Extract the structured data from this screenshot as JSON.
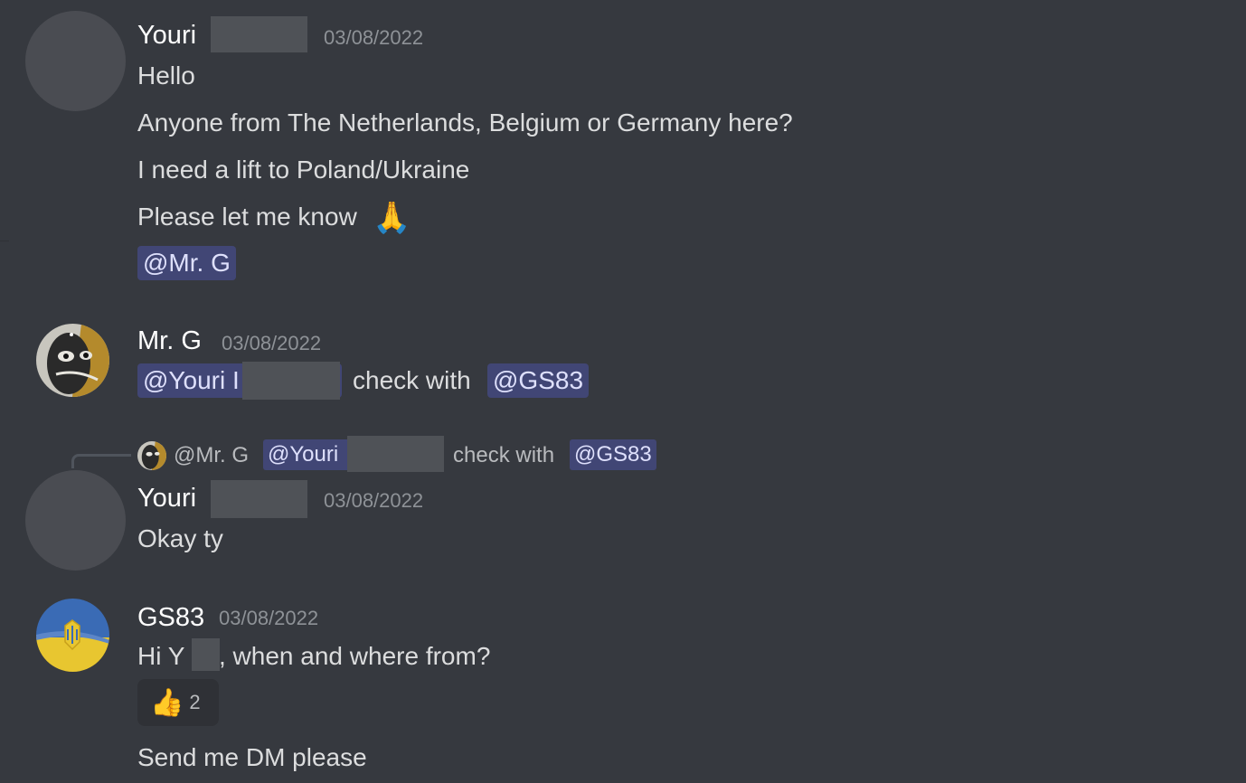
{
  "messages": {
    "m1": {
      "author": "Youri",
      "timestamp": "03/08/2022",
      "lines": [
        "Hello",
        "Anyone from The Netherlands, Belgium or Germany here?",
        "I need a lift to Poland/Ukraine",
        "Please let me know"
      ],
      "emoji": "🙏",
      "mention": "@Mr. G"
    },
    "m2": {
      "author": "Mr. G",
      "timestamp": "03/08/2022",
      "mention1": "@Youri I",
      "text": "check with",
      "mention2": "@GS83"
    },
    "m3": {
      "reply": {
        "author": "@Mr. G",
        "mention1": "@Youri",
        "text": "check with",
        "mention2": "@GS83"
      },
      "author": "Youri",
      "timestamp": "03/08/2022",
      "text": "Okay ty"
    },
    "m4": {
      "author": "GS83",
      "timestamp": "03/08/2022",
      "text_before": "Hi Y",
      "text_after": ", when and where from?",
      "reaction": {
        "emoji": "👍",
        "count": "2"
      },
      "text2": "Send me DM please"
    }
  }
}
